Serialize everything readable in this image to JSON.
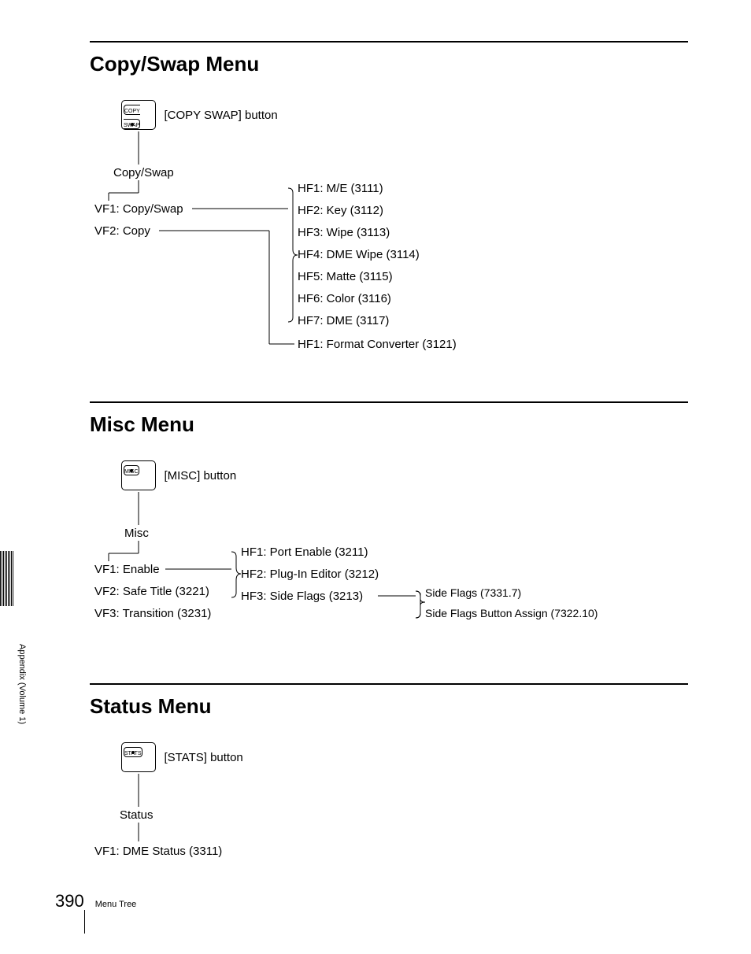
{
  "side_text": "Appendix (Volume 1)",
  "page_number": "390",
  "footer_label": "Menu Tree",
  "sections": {
    "copyswap": {
      "title": "Copy/Swap Menu",
      "button_text_l1": "COPY",
      "button_text_l2": "SWAP",
      "button_label": "[COPY SWAP] button",
      "root": "Copy/Swap",
      "vf1": "VF1: Copy/Swap",
      "vf2": "VF2: Copy",
      "hf1": "HF1: M/E (3111)",
      "hf2": "HF2: Key (3112)",
      "hf3": "HF3: Wipe (3113)",
      "hf4": "HF4: DME Wipe (3114)",
      "hf5": "HF5: Matte (3115)",
      "hf6": "HF6: Color (3116)",
      "hf7": "HF7: DME (3117)",
      "hf_copy": "HF1: Format Converter (3121)"
    },
    "misc": {
      "title": "Misc Menu",
      "button_text": "MISC",
      "button_label": "[MISC] button",
      "root": "Misc",
      "vf1": "VF1: Enable",
      "vf2": "VF2: Safe Title (3221)",
      "vf3": "VF3: Transition (3231)",
      "hf1": "HF1: Port Enable (3211)",
      "hf2": "HF2: Plug-In Editor (3212)",
      "hf3": "HF3: Side Flags (3213)",
      "sf1": "Side Flags (7331.7)",
      "sf2": "Side Flags Button Assign (7322.10)"
    },
    "status": {
      "title": "Status Menu",
      "button_text": "STATS",
      "button_label": "[STATS] button",
      "root": "Status",
      "vf1": "VF1: DME Status (3311)"
    }
  }
}
